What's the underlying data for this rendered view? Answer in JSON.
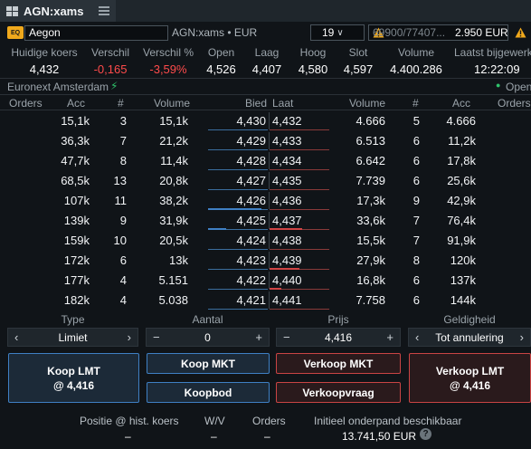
{
  "title": "AGN:xams",
  "instrument": {
    "badge": "EQ",
    "name": "Aegon",
    "symbol_info": "AGN:xams • EUR",
    "stepper_value": "19",
    "account_number": "69900/77407...",
    "account_amount": "2.950 EUR"
  },
  "quote": {
    "headers": [
      "Huidige koers",
      "Verschil",
      "Verschil %",
      "Open",
      "Laag",
      "Hoog",
      "Slot",
      "Volume",
      "Laatst bijgewerkt"
    ],
    "values": [
      "4,432",
      "-0,165",
      "-3,59%",
      "4,526",
      "4,407",
      "4,580",
      "4,597",
      "4.400.286",
      "12:22:09"
    ]
  },
  "market": {
    "name": "Euronext Amsterdam",
    "status": "Open"
  },
  "book_headers": [
    "Orders",
    "Acc",
    "#",
    "Volume",
    "Bied",
    "Laat",
    "Volume",
    "#",
    "Acc",
    "Orders"
  ],
  "book_rows": [
    {
      "acc_b": "15,1k",
      "n_b": "3",
      "vol_b": "15,1k",
      "bid": "4,430",
      "ask": "4,432",
      "vol_a": "4.666",
      "n_a": "5",
      "acc_a": "4.666",
      "bidbar": 0.0,
      "askbar": 0.0
    },
    {
      "acc_b": "36,3k",
      "n_b": "7",
      "vol_b": "21,2k",
      "bid": "4,429",
      "ask": "4,433",
      "vol_a": "6.513",
      "n_a": "6",
      "acc_a": "11,2k",
      "bidbar": 0.0,
      "askbar": 0.0
    },
    {
      "acc_b": "47,7k",
      "n_b": "8",
      "vol_b": "11,4k",
      "bid": "4,428",
      "ask": "4,434",
      "vol_a": "6.642",
      "n_a": "6",
      "acc_a": "17,8k",
      "bidbar": 0.0,
      "askbar": 0.0
    },
    {
      "acc_b": "68,5k",
      "n_b": "13",
      "vol_b": "20,8k",
      "bid": "4,427",
      "ask": "4,435",
      "vol_a": "7.739",
      "n_a": "6",
      "acc_a": "25,6k",
      "bidbar": 0.0,
      "askbar": 0.0
    },
    {
      "acc_b": "107k",
      "n_b": "11",
      "vol_b": "38,2k",
      "bid": "4,426",
      "ask": "4,436",
      "vol_a": "17,3k",
      "n_a": "9",
      "acc_a": "42,9k",
      "bidbar": 0.9,
      "askbar": 0.0
    },
    {
      "acc_b": "139k",
      "n_b": "9",
      "vol_b": "31,9k",
      "bid": "4,425",
      "ask": "4,437",
      "vol_a": "33,6k",
      "n_a": "7",
      "acc_a": "76,4k",
      "bidbar": 0.3,
      "askbar": 0.55
    },
    {
      "acc_b": "159k",
      "n_b": "10",
      "vol_b": "20,5k",
      "bid": "4,424",
      "ask": "4,438",
      "vol_a": "15,5k",
      "n_a": "7",
      "acc_a": "91,9k",
      "bidbar": 0.0,
      "askbar": 0.0
    },
    {
      "acc_b": "172k",
      "n_b": "6",
      "vol_b": "13k",
      "bid": "4,423",
      "ask": "4,439",
      "vol_a": "27,9k",
      "n_a": "8",
      "acc_a": "120k",
      "bidbar": 0.0,
      "askbar": 0.5
    },
    {
      "acc_b": "177k",
      "n_b": "4",
      "vol_b": "5.151",
      "bid": "4,422",
      "ask": "4,440",
      "vol_a": "16,8k",
      "n_a": "6",
      "acc_a": "137k",
      "bidbar": 0.0,
      "askbar": 0.2
    },
    {
      "acc_b": "182k",
      "n_b": "4",
      "vol_b": "5.038",
      "bid": "4,421",
      "ask": "4,441",
      "vol_a": "7.758",
      "n_a": "6",
      "acc_a": "144k",
      "bidbar": 0.0,
      "askbar": 0.0
    }
  ],
  "order_entry": {
    "type_label": "Type",
    "type_value": "Limiet",
    "qty_label": "Aantal",
    "qty_value": "0",
    "price_label": "Prijs",
    "price_value": "4,416",
    "validity_label": "Geldigheid",
    "validity_value": "Tot annulering"
  },
  "buttons": {
    "koop_lmt_line1": "Koop LMT",
    "koop_lmt_line2": "@ 4,416",
    "koop_mkt": "Koop MKT",
    "koopbod": "Koopbod",
    "verkoop_mkt": "Verkoop MKT",
    "verkoopvraag": "Verkoopvraag",
    "verkoop_lmt_line1": "Verkoop LMT",
    "verkoop_lmt_line2": "@ 4,416"
  },
  "summary": {
    "positie_label": "Positie @ hist. koers",
    "positie_value": "–",
    "wv_label": "W/V",
    "wv_value": "–",
    "orders_label": "Orders",
    "orders_value": "–",
    "onderpand_label": "Initieel onderpand beschikbaar",
    "onderpand_value": "13.741,50 EUR"
  },
  "colors": {
    "buy": "#3f80c4",
    "sell": "#c94444",
    "negative": "#ff4b4b",
    "live": "#2fc36b",
    "warning": "#f0a91c"
  },
  "icons": {
    "window": "grid-icon",
    "menu": "hamburger-icon",
    "warning": "warning-triangle-icon",
    "live": "lightning-icon",
    "help": "question-icon"
  }
}
